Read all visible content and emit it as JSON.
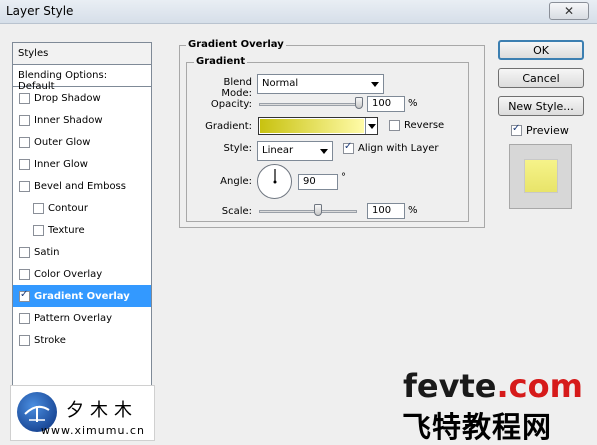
{
  "window": {
    "title": "Layer Style",
    "close_icon": "close-icon"
  },
  "styles_panel": {
    "header": "Styles",
    "blending_options": "Blending Options: Default",
    "items": [
      {
        "label": "Drop Shadow",
        "checked": false,
        "sub": false,
        "selected": false
      },
      {
        "label": "Inner Shadow",
        "checked": false,
        "sub": false,
        "selected": false
      },
      {
        "label": "Outer Glow",
        "checked": false,
        "sub": false,
        "selected": false
      },
      {
        "label": "Inner Glow",
        "checked": false,
        "sub": false,
        "selected": false
      },
      {
        "label": "Bevel and Emboss",
        "checked": false,
        "sub": false,
        "selected": false
      },
      {
        "label": "Contour",
        "checked": false,
        "sub": true,
        "selected": false
      },
      {
        "label": "Texture",
        "checked": false,
        "sub": true,
        "selected": false
      },
      {
        "label": "Satin",
        "checked": false,
        "sub": false,
        "selected": false
      },
      {
        "label": "Color Overlay",
        "checked": false,
        "sub": false,
        "selected": false
      },
      {
        "label": "Gradient Overlay",
        "checked": true,
        "sub": false,
        "selected": true
      },
      {
        "label": "Pattern Overlay",
        "checked": false,
        "sub": false,
        "selected": false
      },
      {
        "label": "Stroke",
        "checked": false,
        "sub": false,
        "selected": false
      }
    ]
  },
  "gradient_overlay": {
    "group_title": "Gradient Overlay",
    "inner_title": "Gradient",
    "blend_mode_label": "Blend Mode:",
    "blend_mode_value": "Normal",
    "opacity_label": "Opacity:",
    "opacity_value": "100",
    "opacity_unit": "%",
    "opacity_fraction": 1.0,
    "gradient_label": "Gradient:",
    "gradient_colors": [
      "#c8c210",
      "#fffba8"
    ],
    "reverse_label": "Reverse",
    "reverse_checked": false,
    "style_label": "Style:",
    "style_value": "Linear",
    "align_label": "Align with Layer",
    "align_checked": true,
    "angle_label": "Angle:",
    "angle_value": "90",
    "angle_unit": "°",
    "scale_label": "Scale:",
    "scale_value": "100",
    "scale_unit": "%",
    "scale_fraction": 0.6
  },
  "buttons": {
    "ok": "OK",
    "cancel": "Cancel",
    "new_style": "New Style...",
    "preview_label": "Preview",
    "preview_checked": true
  },
  "watermark": {
    "logo_text": "夕木木",
    "logo_url": "www.ximumu.cn",
    "brand_text": "fevte",
    "brand_domain": ".com",
    "brand_cn": "飞特教程网"
  },
  "colors": {
    "selection": "#3399ff",
    "ok_border": "#3c7fb1",
    "preview_fill": "#f0ec7e"
  }
}
